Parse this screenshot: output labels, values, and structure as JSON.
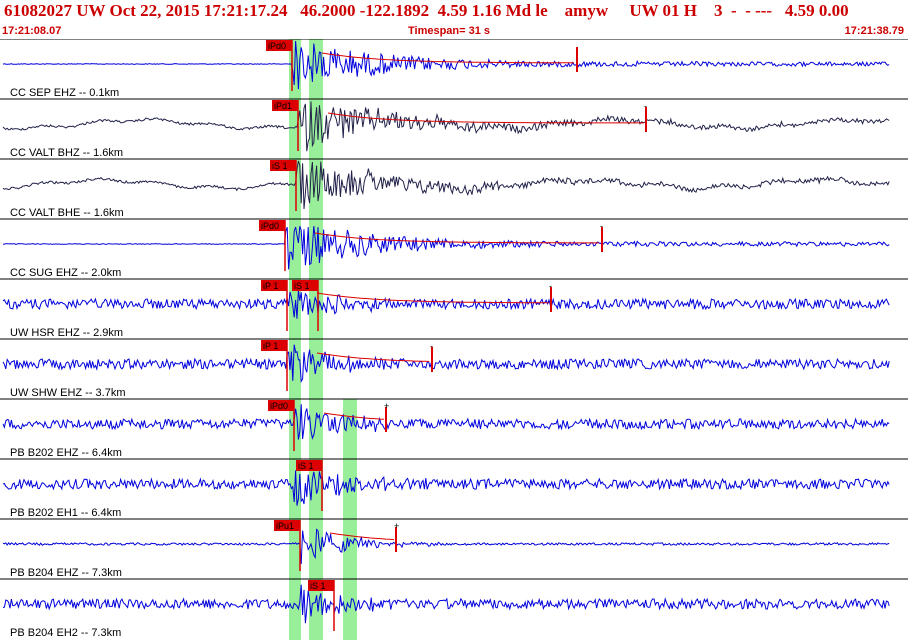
{
  "header": {
    "title": "61082027 UW Oct 22, 2015 17:21:17.24   46.2000 -122.1892  4.59 1.16 Md le    amyw     UW 01 H    3  -  - ---   4.59 0.00",
    "start_time": "17:21:08.07",
    "timespan": "Timespan=  31 s",
    "end_time": "17:21:38.79"
  },
  "colors": {
    "title_red": "#cc0000",
    "trace_blue": "#0000dd",
    "trace_navy": "#22224a",
    "pick_red": "#dd0000",
    "window_green": "#99ee99"
  },
  "channels": [
    {
      "label": "CC SEP EHZ -- 0.1km",
      "color": "blue",
      "p_pick": "iPd0",
      "s_pick": "",
      "coda": "",
      "amp": "low"
    },
    {
      "label": "CC VALT BHZ -- 1.6km",
      "color": "navy",
      "p_pick": "iPd1",
      "s_pick": "",
      "coda": "-",
      "amp": "med"
    },
    {
      "label": "CC VALT BHE -- 1.6km",
      "color": "navy",
      "p_pick": "",
      "s_pick": "iS 1",
      "coda": "",
      "amp": "med"
    },
    {
      "label": "CC SUG EHZ -- 2.0km",
      "color": "blue",
      "p_pick": "iPd0",
      "s_pick": "",
      "coda": "-",
      "amp": "low"
    },
    {
      "label": "UW HSR EHZ -- 2.9km",
      "color": "blue",
      "p_pick": "iP 1",
      "s_pick": "iS 1",
      "coda": "-",
      "amp": "high"
    },
    {
      "label": "UW SHW EHZ -- 3.7km",
      "color": "blue",
      "p_pick": "iP 1",
      "s_pick": "",
      "coda": "-",
      "amp": "high"
    },
    {
      "label": "PB B202 EHZ -- 6.4km",
      "color": "blue",
      "p_pick": "iPd0",
      "s_pick": "",
      "coda": "+",
      "amp": "high"
    },
    {
      "label": "PB B202 EH1 -- 6.4km",
      "color": "blue",
      "p_pick": "",
      "s_pick": "iS 1",
      "coda": "",
      "amp": "high"
    },
    {
      "label": "PB B204 EHZ -- 7.3km",
      "color": "blue",
      "p_pick": "iPu1",
      "s_pick": "",
      "coda": "+",
      "amp": "med"
    },
    {
      "label": "PB B204 EH2 -- 7.3km",
      "color": "blue",
      "p_pick": "",
      "s_pick": "iS 1",
      "coda": "",
      "amp": "high"
    }
  ]
}
